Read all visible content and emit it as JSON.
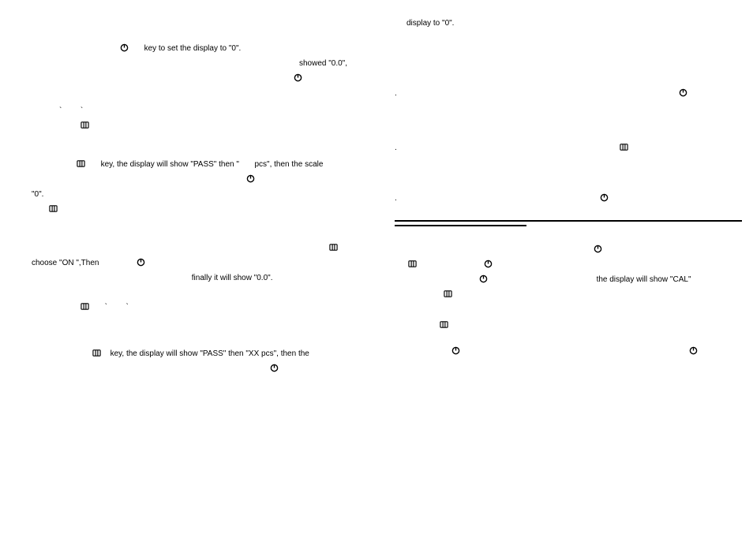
{
  "left": {
    "l1a": "key to set the display to \"0\".",
    "l2a": "showed \"0.0\",",
    "l5a": "`",
    "l5b": "`",
    "l7a": "key, the display will show \"PASS\" then \"",
    "l7b": "pcs\", then the scale",
    "l9a": "\"0\".",
    "l13a": "choose \"ON  \",Then",
    "l13b": "finally it will show \"0.0\".",
    "l15a": "`",
    "l15b": "`",
    "l18a": "key, the display will show \"PASS\" then \"XX pcs\", then the"
  },
  "right": {
    "r0a": "display to \"0\".",
    "r4a": ".",
    "r6a": ".",
    "r8a": ".",
    "r14a": "the display will show \"CAL\""
  }
}
